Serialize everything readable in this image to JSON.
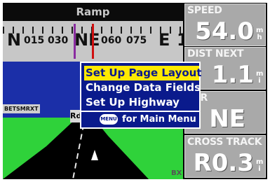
{
  "map": {
    "title": "Ramp",
    "compass": {
      "labels": [
        "N",
        "015",
        "030",
        "NE",
        "060",
        "075",
        "E",
        "1"
      ]
    },
    "scale_label": "BETSMRXT",
    "waypoint_label": "Rd",
    "corner_label": "BX"
  },
  "fields": [
    {
      "label": "SPEED",
      "value": "54.0",
      "unit_top": "m",
      "unit_bottom": "h"
    },
    {
      "label": "DIST NEXT",
      "value": "1.1",
      "unit_top": "m",
      "unit_bottom": "i"
    },
    {
      "label": "EER",
      "value": "NE",
      "unit_top": "",
      "unit_bottom": ""
    },
    {
      "label": "CROSS TRACK",
      "value": "R0.3",
      "unit_top": "m",
      "unit_bottom": "i"
    }
  ],
  "menu": {
    "items": [
      "Set Up Page Layout",
      "Change Data Fields",
      "Set Up Highway"
    ],
    "selected_index": 0,
    "menu_button": "MENU",
    "footer_text": "for Main Menu"
  },
  "colors": {
    "sky": "#1b2fa8",
    "ground": "#2fd23a",
    "menu_bg": "#0a1a8c",
    "highlight": "#ffea00",
    "field_bg": "#a9a9a9"
  }
}
